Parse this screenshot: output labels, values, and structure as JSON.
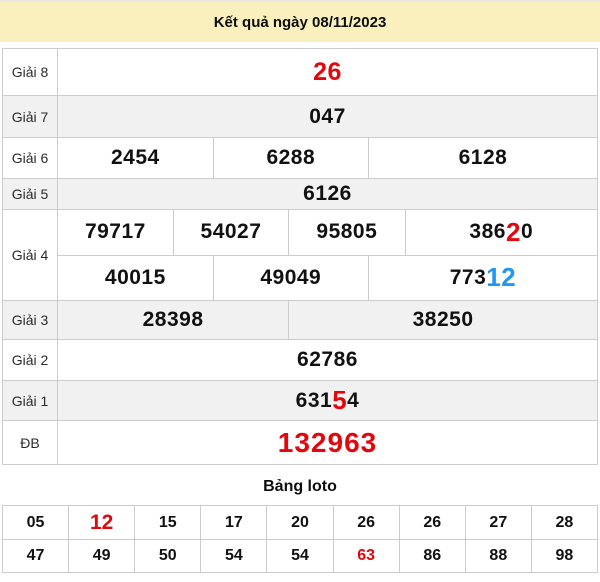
{
  "header": {
    "title": "Kết quả ngày 08/11/2023"
  },
  "colors": {
    "header_bg": "#faf0bd",
    "red_highlight": "#e2070d",
    "blue_highlight": "#2196f3",
    "row_alt_bg": "#f1f1f1",
    "border": "#cccccc"
  },
  "results": {
    "rows": [
      {
        "label": "Giải 8",
        "cells": [
          {
            "text": "26"
          }
        ]
      },
      {
        "label": "Giải 7",
        "cells": [
          {
            "text": "047"
          }
        ]
      },
      {
        "label": "Giải 6",
        "cells": [
          {
            "text": "2454"
          },
          {
            "text": "6288"
          },
          {
            "text": "6128"
          }
        ]
      },
      {
        "label": "Giải 5",
        "cells": [
          {
            "text": "6126"
          }
        ]
      },
      {
        "label": "Giải 4",
        "line1": [
          {
            "text": "79717"
          },
          {
            "text": "54027"
          },
          {
            "text": "95805"
          },
          {
            "pre": "386",
            "hl": "2",
            "post": "0"
          }
        ],
        "line2": [
          {
            "text": "40015"
          },
          {
            "text": "49049"
          },
          {
            "pre": "773",
            "hl": "12",
            "post": ""
          }
        ]
      },
      {
        "label": "Giải 3",
        "cells": [
          {
            "text": "28398"
          },
          {
            "text": "38250"
          }
        ]
      },
      {
        "label": "Giải 2",
        "cells": [
          {
            "text": "62786"
          }
        ]
      },
      {
        "label": "Giải 1",
        "cells": [
          {
            "pre": "631",
            "hl": "5",
            "post": "4"
          }
        ]
      },
      {
        "label": "ĐB",
        "cells": [
          {
            "text": "132963"
          }
        ]
      }
    ]
  },
  "loto": {
    "title": "Bảng loto",
    "row1": [
      "05",
      "12",
      "15",
      "17",
      "20",
      "26",
      "26",
      "27",
      "28"
    ],
    "row2": [
      "47",
      "49",
      "50",
      "54",
      "54",
      "63",
      "86",
      "88",
      "98"
    ]
  }
}
